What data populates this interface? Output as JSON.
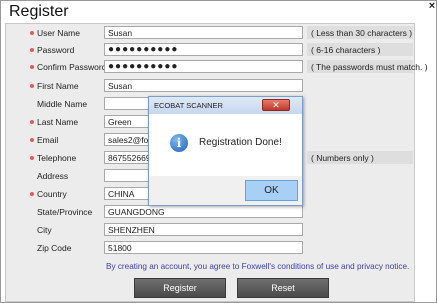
{
  "window": {
    "title": "Register",
    "close_glyph": "×"
  },
  "fields": [
    {
      "label": "User Name",
      "required": true,
      "value": "Susan",
      "hint": "( Less than 30 characters )"
    },
    {
      "label": "Password",
      "required": true,
      "value": "●●●●●●●●●●",
      "hint": "( 6-16 characters )"
    },
    {
      "label": "Confirm Password",
      "required": true,
      "value": "●●●●●●●●●●",
      "hint": "( The passwords must match. )"
    },
    {
      "label": "First Name",
      "required": true,
      "value": "Susan",
      "hint": ""
    },
    {
      "label": "Middle Name",
      "required": false,
      "value": "",
      "hint": ""
    },
    {
      "label": "Last Name",
      "required": true,
      "value": "Green",
      "hint": ""
    },
    {
      "label": "Email",
      "required": true,
      "value": "sales2@foxw",
      "hint": ""
    },
    {
      "label": "Telephone",
      "required": true,
      "value": "86755266972",
      "hint": "( Numbers only )"
    },
    {
      "label": "Address",
      "required": false,
      "value": "",
      "hint": ""
    },
    {
      "label": "Country",
      "required": true,
      "value": "CHINA",
      "hint": ""
    },
    {
      "label": "State/Province",
      "required": false,
      "value": "GUANGDONG",
      "hint": ""
    },
    {
      "label": "City",
      "required": false,
      "value": "SHENZHEN",
      "hint": ""
    },
    {
      "label": "Zip Code",
      "required": false,
      "value": "51800",
      "hint": ""
    }
  ],
  "agreement": "By creating an account, you agree to Foxwell's conditions of use and privacy notice.",
  "buttons": {
    "register": "Register",
    "reset": "Reset"
  },
  "dialog": {
    "title": "ECOBAT SCANNER",
    "close_glyph": "✕",
    "icon": "info-icon",
    "icon_glyph": "i",
    "message": "Registration Done!",
    "ok_label": "OK"
  },
  "colors": {
    "required_dot": "#e05a5a",
    "agreement_text": "#3b3bb8",
    "ok_button": "#a8d0f5"
  }
}
